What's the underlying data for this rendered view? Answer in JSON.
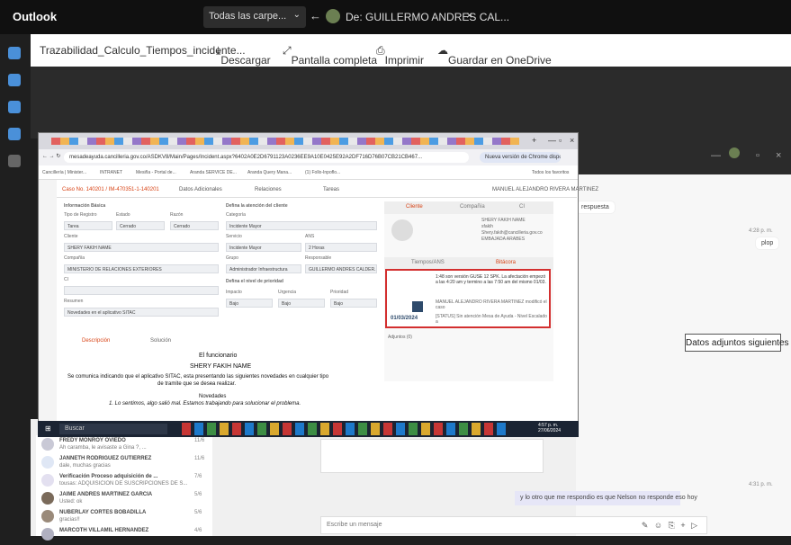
{
  "titlebar": {
    "app": "Outlook",
    "search_label": "Todas las carpe...",
    "tab_label": "De: GUILLERMO ANDRES CAL...",
    "close_glyph": "×",
    "back_glyph": "←",
    "chevron_glyph": "⌄"
  },
  "toolbar": {
    "filename": "Trazabilidad_Calculo_Tiempos_incidente...",
    "download": "Descargar",
    "fullscreen": "Pantalla completa",
    "print": "Imprimir",
    "onedrive": "Guardar en OneDrive"
  },
  "background_chat": {
    "respuesta": "respuesta",
    "time1": "4:28 p. m.",
    "bubble1": "plop",
    "datos_adjuntos": "Datos adjuntos siguientes",
    "time2": "4:31 p. m.",
    "reply": "y lo otro que me respondio es que Nelson no responde eso hoy",
    "input_placeholder": "Escribe un mensaje",
    "contacts": [
      {
        "name": "FREDY MONROY OVIEDO",
        "preview": "Ah caramba, le avisaste a Gina ?, ...",
        "date": "11/6"
      },
      {
        "name": "JANNETH RODRIGUEZ GUTIERREZ",
        "preview": "dale, muchas gracias",
        "date": "11/6"
      },
      {
        "name": "Verificación Proceso adquisición de ...",
        "preview": "tousas: ADQUISICION DE SUSCRIPCIONES DE S...",
        "date": "7/6"
      },
      {
        "name": "JAIME ANDRES MARTINEZ GARCIA",
        "preview": "Usted: ok",
        "date": "5/6"
      },
      {
        "name": "NUBERLAY CORTES BOBADILLA",
        "preview": "gracias!!",
        "date": "5/6"
      },
      {
        "name": "MARCOTH VILLAMIL HERNANDEZ",
        "preview": "",
        "date": "4/6"
      }
    ]
  },
  "screenshot": {
    "url": "mesadeayuda.cancilleria.gov.co/ASDKV8/Main/Pages/Incident.aspx?6402A0E2D6791123A0236EE9A10E0425E92A2DF716D76B07CB21CB467...",
    "update_text": "Nueva versión de Chrome disponible",
    "bookmarks": [
      "Cancillería | Minister...",
      "INTRANET",
      "Mesiña - Portal de...",
      "Aranda SERVICE DE...",
      "Aranda Query Mana...",
      "(1) Follo-Inpoflo..."
    ],
    "all_bookmarks": "Todos los favoritos",
    "case_title": "Caso No. 140201 / IM-470351-1-140201",
    "tab_adicionales": "Datos Adicionales",
    "tab_relaciones": "Relaciones",
    "tab_tareas": "Tareas",
    "agent_name": "MANUEL ALEJANDRO RIVERA MARTINEZ",
    "info_basica": "Información Básica",
    "tipo_registro": "Tipo de Registro",
    "estado": "Estado",
    "razon": "Razón",
    "tipo_value": "Tarea",
    "estado_value": "Cerrado",
    "razon_value": "Cerrado",
    "cliente_label": "Cliente",
    "cliente_value": "SHERY FAKIH NAME",
    "compania_label": "Compañía",
    "compania_value": "MINISTERIO DE RELACIONES EXTERIORES",
    "ci_label": "CI",
    "resumen_label": "Resumen",
    "resumen_value": "Novedades en el aplicativo SITAC",
    "atencion": "Defina la atención del cliente",
    "categoria_label": "Categoría",
    "categoria_value": "Incidente Mayor",
    "servicio_label": "Servicio",
    "servicio_value": "Incidente Mayor",
    "ans_label": "ANS",
    "ans_value": "2 Horas",
    "grupo_label": "Grupo",
    "grupo_value": "Administrador Infraestructura",
    "responsable_label": "Responsable",
    "responsable_value": "GUILLERMO ANDRES CALDER...",
    "prioridad_title": "Defina el nivel de prioridad",
    "impacto_label": "Impacto",
    "urgencia_label": "Urgencia",
    "prioridad_label": "Prioridad",
    "impacto_value": "Bajo",
    "urgencia_value": "Bajo",
    "prioridad_value": "Bajo",
    "pr_tab_cliente": "Cliente",
    "pr_tab_compania": "Compañía",
    "pr_tab_ci": "CI",
    "cliente_nombre": "SHERY FAKIH NAME",
    "cliente_alias": "sfakih",
    "cliente_correo": "Shery.fakih@cancilleria.gov.co",
    "cliente_pais": "EMBAJADA ARABES",
    "tiempos": "Tiempos/ANS",
    "bitacora": "Bitácora",
    "bitacora_text": "1:48 son versión GUSE 12 SPK. La afectación empezó a las 4:20 am y termino a las 7:50 am del mismo 01/03.",
    "bitacora_author": "MANUEL ALEJANDRO RIVERA MARTINEZ modificó el caso",
    "bitacora_date": "01/03/2024",
    "bitacora_status": "[STATUS] Sin atención Mesa de Ayuda - Nivel Escalado a",
    "adjuntos": "Adjuntos (0)",
    "doc_tab1": "Descripción",
    "doc_tab2": "Solución",
    "doc_line1": "El funcionario",
    "doc_line2": "SHERY FAKIH NAME",
    "doc_line3": "Se comunica indicando que el aplicativo SITAC, esta presentando las siguientes novedades en cualquier tipo",
    "doc_line4": "de tramite que se desea realizar.",
    "doc_line5": "Novedades",
    "doc_line6": "1. Lo sentimos, algo salió mal. Estamos trabajando para solucionar el problema.",
    "taskbar_search": "Buscar",
    "taskbar_time": "4:57 p. m.",
    "taskbar_date": "27/06/2024"
  },
  "colors": {
    "titlebar": "#101010",
    "accent_red": "#d32f2f",
    "chrome_dark": "#1b2433"
  }
}
